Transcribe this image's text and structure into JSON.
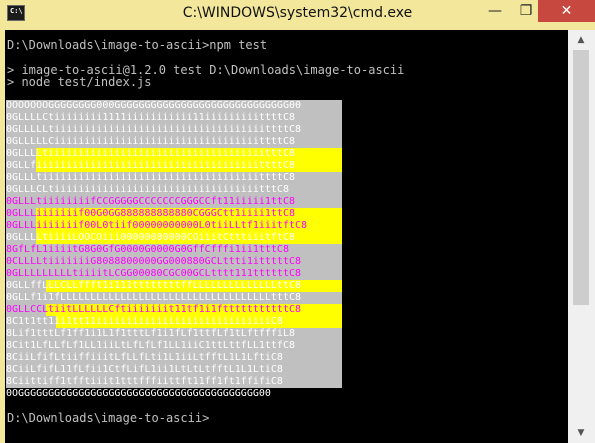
{
  "window": {
    "title": "C:\\WINDOWS\\system32\\cmd.exe",
    "icon_label": "C:\\",
    "minimize_glyph": "—",
    "maximize_glyph": "❐",
    "close_glyph": "✕",
    "accent_color": "#f3e79b",
    "close_color": "#c7483f"
  },
  "console": {
    "lines": [
      "D:\\Downloads\\image-to-ascii>npm test",
      "> image-to-ascii@1.2.0 test D:\\Downloads\\image-to-ascii",
      "> node test/index.js",
      "D:\\Downloads\\image-to-ascii>"
    ],
    "background_color": "#000000",
    "text_color": "#c0c0c0"
  },
  "ascii_art": {
    "rows": [
      "OOOOOOOGGGGGGGG000GGGGGGGGGGGGGGGGGGGGGGGGGGGGG00",
      "0GLLLLCtiiiiiiii1111iiiiiiiiiii11iiiiiiiiittttC8",
      "0GLLLLLtiiiiiiiiiiiiiiiiiiiiiiiiiiiiiiiiiiittttC8",
      "0GLLLLLCiiiiiiiiiiiiiiiiiiiiiiiiiiiiiiiiiittttC8",
      "0GLLLLtiiiiiiiiiiiiiiiiiiiiiiiiiiiiiiiiiiiitttC8",
      "0GLLfiiiiiiiiiiiiiiiiiiiiiiiiiiiiiiiiiiiiittttC8",
      "0GLLLtiiiiiiiiiiiiiiiiiiiiiiiiiiiiiiiiiiiittttC8",
      "0GLLLCLtiiiiiiiiiiiiiiiiiiiiiiiiiiiiiiiiiitttC8",
      "0GLLLtiiiiiiiifCCGGGGGCCCCCCCGGGCCft11iiiii1ttC8",
      "0GLLLiiiiiiif00G0GG888888888880CGGGCtt1iiii1ttC8",
      "0GLLLiiiiiiif00L0tiif00000000000L0tiiLLtf1iiitftC8",
      "0GLLLLtiiiiLOOCOiii00000080000COiiitCtttiiitftC8",
      "8GfLfL1iiiitG8G0GfG0000G0000G0GffCfffi1ii1tttC8",
      "0CLLLLtiiiiiiiG8088800000GG000880GCLttti1itttttC8",
      "0GLLLLLLLLLtiiiitLCGG00080CGC00GCLtttt111ttttttC8",
      "0GLLffLLLCLLffft1i111ttttttttffLLLLLLLLLLLLLLttC8",
      "0GLLf1i1fLLLLLLLLLLLLLLLLLLLLLLLLLLLLLLLLLLLtttC8",
      "0GLLCCLtiitLLLLLLCftiiiiiiit11tf1i1ftttttttttttC8",
      "8C1t1tt1ii1tt11iiiiiiiiiiiiiiiiiiiiiiiiiiiiiC8",
      "8Lif1tttLf1ff1i1L1f1tttLf1i1fLf1ttfLf1tLftfffiL8",
      "8Cit1LfLLfLf1LL1iiLtLfLfLf1LL1iiC1ttLttfLL1ttfC8",
      "8CiiLfifLtiiffiiitLfLLfLti1L1iiLtfftL1L1LftiC8",
      "8CiiLfifL11fLfii1CtfLifL1ii1LtLtLtfftL1L1LtiC8",
      "8Ciittiff1tfftiiit1tttfffiittft11ff1ft1ffifiC8",
      "0OGGGGGGGGGGGGGGGGGGGGGGGGGGGGGGGGGGGGGGGG00"
    ],
    "background_color": "#c0c0c0",
    "highlight_color": "#ffff00",
    "accent_text_color": "#ff00ff"
  },
  "scrollbar": {
    "up_glyph": "▲",
    "down_glyph": "▼",
    "thumb_fraction": 0.63
  }
}
